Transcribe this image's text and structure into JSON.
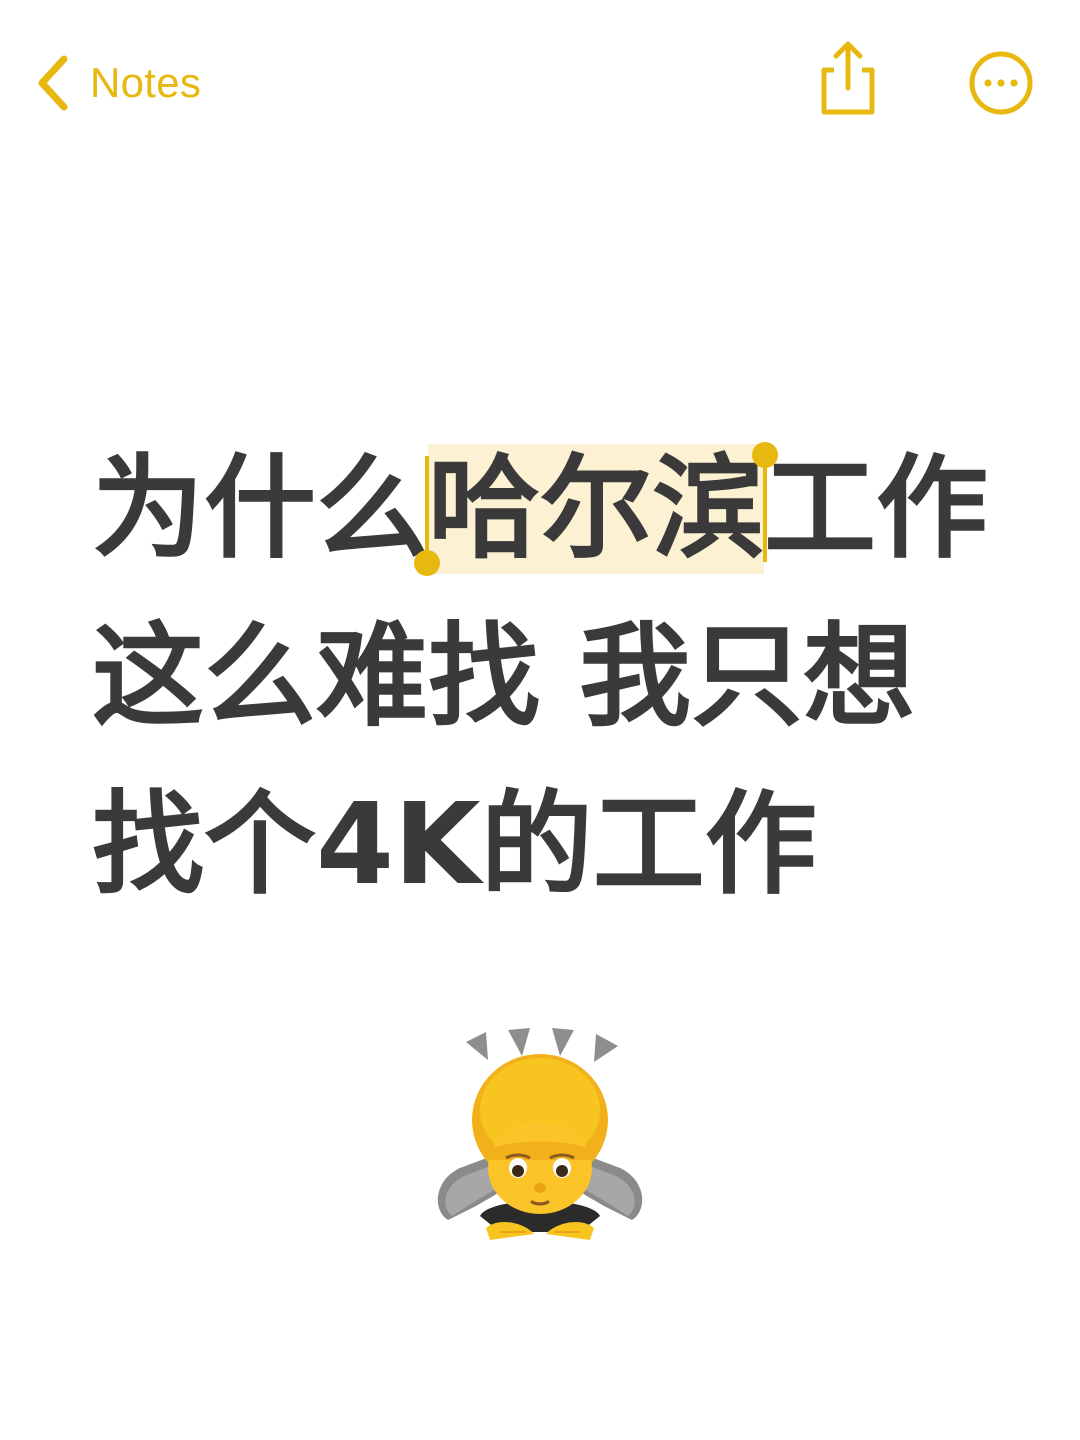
{
  "nav": {
    "back_label": "Notes",
    "back_icon": "chevron-left-icon",
    "share_icon": "share-icon",
    "more_icon": "ellipsis-circle-icon"
  },
  "note": {
    "line1_before": "为什么",
    "line1_selected": "哈尔滨",
    "line1_after": "工作",
    "line2": "这么难找 我只想",
    "line3": "找个4K的工作"
  },
  "emoji": {
    "name": "person-bowing-icon"
  },
  "colors": {
    "accent": "#e7b80f",
    "text": "#3a3a3a",
    "selection": "#fcf1d2",
    "background": "#ffffff"
  }
}
